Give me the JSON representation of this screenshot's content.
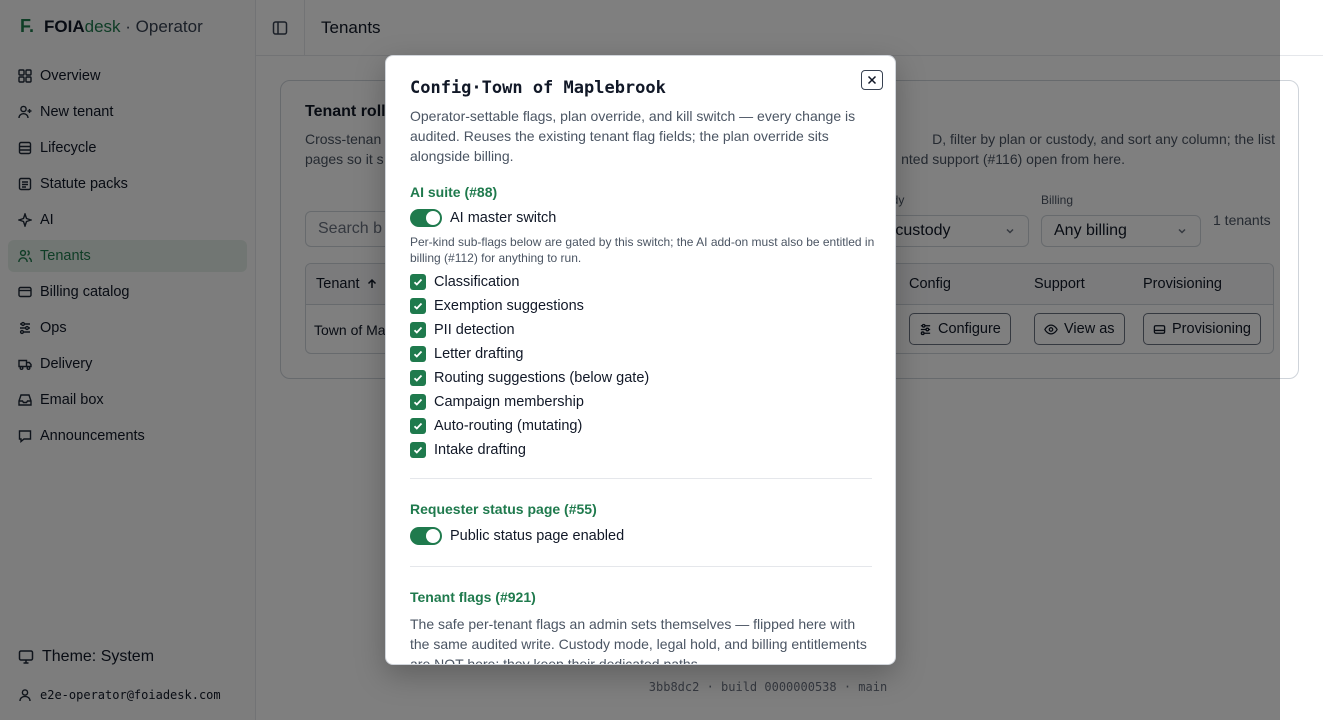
{
  "sidebar": {
    "brand": {
      "mark": "F.",
      "foia": "FOIA",
      "desk": "desk",
      "rest": " · Operator"
    },
    "items": [
      {
        "label": "Overview",
        "icon": "grid-icon"
      },
      {
        "label": "New tenant",
        "icon": "user-plus-icon"
      },
      {
        "label": "Lifecycle",
        "icon": "layers-icon"
      },
      {
        "label": "Statute packs",
        "icon": "list-icon"
      },
      {
        "label": "AI",
        "icon": "sparkle-icon"
      },
      {
        "label": "Tenants",
        "icon": "users-icon",
        "active": true
      },
      {
        "label": "Billing catalog",
        "icon": "card-icon"
      },
      {
        "label": "Ops",
        "icon": "sliders-icon"
      },
      {
        "label": "Delivery",
        "icon": "truck-icon"
      },
      {
        "label": "Email box",
        "icon": "inbox-icon"
      },
      {
        "label": "Announcements",
        "icon": "chat-icon"
      }
    ],
    "theme": "Theme: System",
    "user": "e2e-operator@foiadesk.com"
  },
  "topbar": {
    "title": "Tenants"
  },
  "card": {
    "title": "Tenant roll",
    "desc_line1": "Cross-tenan",
    "desc_line1_right": "D, filter by plan or custody, and sort any column; the list",
    "desc_line2": "pages so it s",
    "desc_line2_right": "nted support (#116) open from here.",
    "search_placeholder": "Search b",
    "custody_label": "ody",
    "custody_value": "ny custody",
    "billing_label": "Billing",
    "billing_value": "Any billing",
    "count": "1 tenants",
    "columns": {
      "tenant": "Tenant",
      "config": "Config",
      "support": "Support",
      "provisioning": "Provisioning"
    },
    "row": {
      "tenant": "Town of Ma",
      "configure": "Configure",
      "view_as": "View as",
      "provisioning": "Provisioning"
    }
  },
  "footer": "3bb8dc2 · build 0000000538 · main",
  "modal": {
    "title": "Config·Town of Maplebrook",
    "desc": "Operator-settable flags, plan override, and kill switch — every change is audited. Reuses the existing tenant flag fields; the plan override sits alongside billing.",
    "ai_section": "AI suite (#88)",
    "ai_master": "AI master switch",
    "ai_hint": "Per-kind sub-flags below are gated by this switch; the AI add-on must also be entitled in billing (#112) for anything to run.",
    "ai_flags": [
      "Classification",
      "Exemption suggestions",
      "PII detection",
      "Letter drafting",
      "Routing suggestions (below gate)",
      "Campaign membership",
      "Auto-routing (mutating)",
      "Intake drafting"
    ],
    "status_section": "Requester status page (#55)",
    "status_switch": "Public status page enabled",
    "flags_section": "Tenant flags (#921)",
    "flags_desc": "The safe per-tenant flags an admin sets themselves — flipped here with the same audited write. Custody mode, legal hold, and billing entitlements are NOT here; they keep their dedicated paths."
  },
  "colors": {
    "accent": "#1f7a4d",
    "overlay": "rgba(0,0,0,0.5)"
  }
}
